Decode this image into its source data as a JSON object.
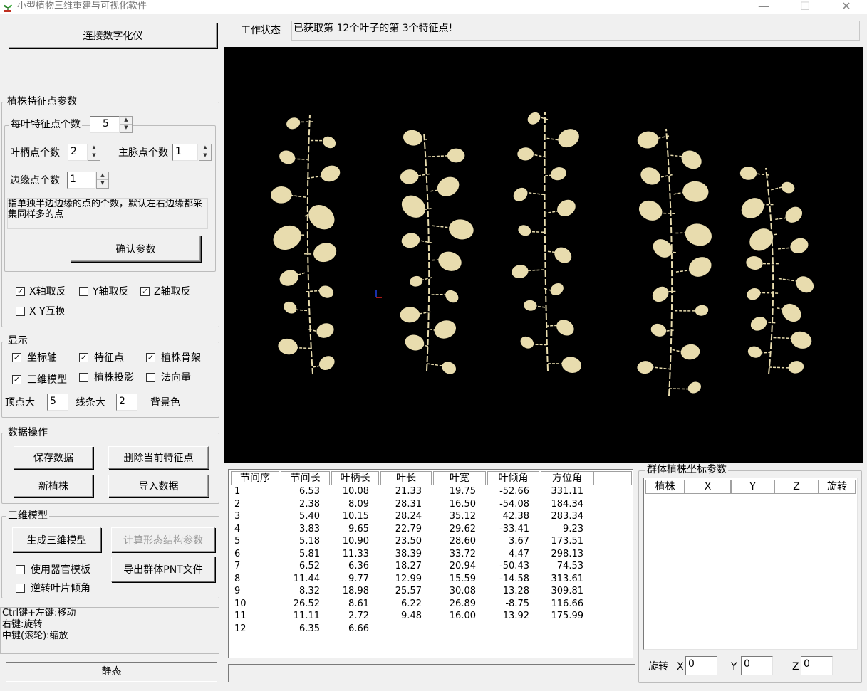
{
  "window": {
    "title": "小型植物三维重建与可视化软件",
    "minimize": "—",
    "maximize": "☐",
    "close": "✕"
  },
  "connect_button": "连接数字化仪",
  "status": {
    "label": "工作状态",
    "value": "已获取第 12个叶子的第 3个特征点!"
  },
  "feature_params": {
    "title": "植株特征点参数",
    "per_leaf_label": "每叶特征点个数",
    "per_leaf_value": "5",
    "petiole_label": "叶柄点个数",
    "petiole_value": "2",
    "midrib_label": "主脉点个数",
    "midrib_value": "1",
    "edge_label": "边缘点个数",
    "edge_value": "1",
    "hint": "指单独半边边缘的点的个数，默认左右边缘都采集同样多的点",
    "confirm_button": "确认参数"
  },
  "axis_options": {
    "x_invert": {
      "label": "X轴取反",
      "checked": true
    },
    "y_invert": {
      "label": "Y轴取反",
      "checked": false
    },
    "z_invert": {
      "label": "Z轴取反",
      "checked": true
    },
    "xy_swap": {
      "label": "X Y互换",
      "checked": false
    }
  },
  "display": {
    "title": "显示",
    "axes": {
      "label": "坐标轴",
      "checked": true
    },
    "feature_points": {
      "label": "特征点",
      "checked": true
    },
    "skeleton": {
      "label": "植株骨架",
      "checked": true
    },
    "model3d": {
      "label": "三维模型",
      "checked": true
    },
    "projection": {
      "label": "植株投影",
      "checked": false
    },
    "normals": {
      "label": "法向量",
      "checked": false
    },
    "vertex_size_label": "顶点大",
    "vertex_size_value": "5",
    "line_size_label": "线条大",
    "line_size_value": "2",
    "bg_color_label": "背景色"
  },
  "data_ops": {
    "title": "数据操作",
    "save": "保存数据",
    "delete_point": "删除当前特征点",
    "new_plant": "新植株",
    "import": "导入数据"
  },
  "model3d_section": {
    "title": "三维模型",
    "generate": "生成三维模型",
    "compute": "计算形态结构参数",
    "use_template": {
      "label": "使用器官模板",
      "checked": false
    },
    "export_pnt": "导出群体PNT文件",
    "reverse_leaf": {
      "label": "逆转叶片倾角",
      "checked": false
    }
  },
  "help_text": [
    "Ctrl键+左键:移动",
    "右键:旋转",
    "中键(滚轮):缩放"
  ],
  "mode_status": "静态",
  "leaf_table": {
    "columns": [
      "节间序",
      "节间长",
      "叶柄长",
      "叶长",
      "叶宽",
      "叶倾角",
      "方位角"
    ],
    "rows": [
      [
        "1",
        "6.53",
        "10.08",
        "21.33",
        "19.75",
        "-52.66",
        "331.11"
      ],
      [
        "2",
        "2.38",
        "8.09",
        "28.31",
        "16.50",
        "-54.08",
        "184.34"
      ],
      [
        "3",
        "5.40",
        "10.15",
        "28.24",
        "35.12",
        "42.38",
        "283.34"
      ],
      [
        "4",
        "3.83",
        "9.65",
        "22.79",
        "29.62",
        "-33.41",
        "9.23"
      ],
      [
        "5",
        "5.18",
        "10.90",
        "23.50",
        "28.60",
        "3.67",
        "173.51"
      ],
      [
        "6",
        "5.81",
        "11.33",
        "38.39",
        "33.72",
        "4.47",
        "298.13"
      ],
      [
        "7",
        "6.52",
        "6.36",
        "18.27",
        "20.94",
        "-50.43",
        "74.53"
      ],
      [
        "8",
        "11.44",
        "9.77",
        "12.99",
        "15.59",
        "-14.58",
        "313.61"
      ],
      [
        "9",
        "8.32",
        "18.98",
        "25.57",
        "30.08",
        "13.28",
        "309.81"
      ],
      [
        "10",
        "26.52",
        "8.61",
        "6.22",
        "26.89",
        "-8.75",
        "116.66"
      ],
      [
        "11",
        "11.11",
        "2.72",
        "9.48",
        "16.00",
        "13.92",
        "175.99"
      ],
      [
        "12",
        "6.35",
        "6.66",
        "",
        "",
        "",
        ""
      ]
    ]
  },
  "group_coords": {
    "title": "群体植株坐标参数",
    "columns": [
      "植株",
      "X",
      "Y",
      "Z",
      "旋转"
    ],
    "rotate_label": "旋转",
    "x_label": "X",
    "x_value": "0",
    "y_label": "Y",
    "y_value": "0",
    "z_label": "Z",
    "z_value": "0"
  },
  "colors": {
    "leaf": "#e8dcae",
    "viewport_bg": "#000000",
    "axis_x": "#e02020",
    "axis_y": "#2040e0"
  },
  "viewport": {
    "plant_count": 5
  }
}
